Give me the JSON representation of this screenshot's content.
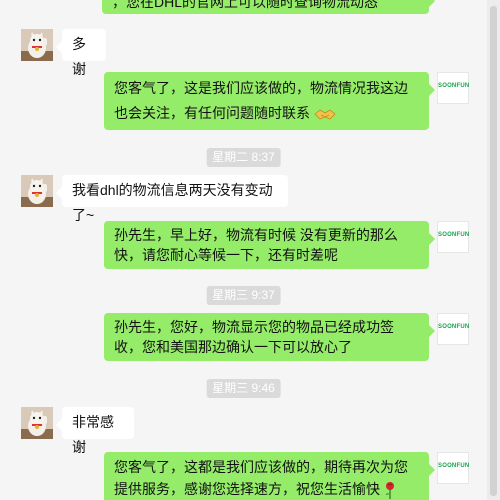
{
  "messages": [
    {
      "side": "right",
      "text": "，您在DHL的官网上可以随时查询物流动态"
    },
    {
      "side": "left",
      "text": "多谢"
    },
    {
      "side": "right",
      "text": "您客气了，这是我们应该做的，物流情况我这边也会关注，有任何问题随时联系",
      "emoji": "handshake-icon"
    },
    {
      "side": "time",
      "text": "星期二 8:37"
    },
    {
      "side": "left",
      "text": "我看dhl的物流信息两天没有变动了~"
    },
    {
      "side": "right",
      "text": "孙先生，早上好，物流有时候 没有更新的那么快，请您耐心等候一下，还有时差呢"
    },
    {
      "side": "time",
      "text": "星期三 9:37"
    },
    {
      "side": "right",
      "text": "孙先生，您好，物流显示您的物品已经成功签收，您和美国那边确认一下可以放心了"
    },
    {
      "side": "time",
      "text": "星期三 9:46"
    },
    {
      "side": "left",
      "text": "非常感谢"
    },
    {
      "side": "right",
      "text": "您客气了，这都是我们应该做的，期待再次为您提供服务，感谢您选择速方，祝您生活愉快",
      "emoji": "rose-icon"
    }
  ],
  "brand": {
    "avatar_text": "SOONFUN",
    "accent": "#17a34a"
  },
  "colors": {
    "bubble_right": "#95ec69",
    "bubble_left": "#ffffff",
    "background": "#f5f5f5",
    "timestamp_bg": "#dadada"
  }
}
